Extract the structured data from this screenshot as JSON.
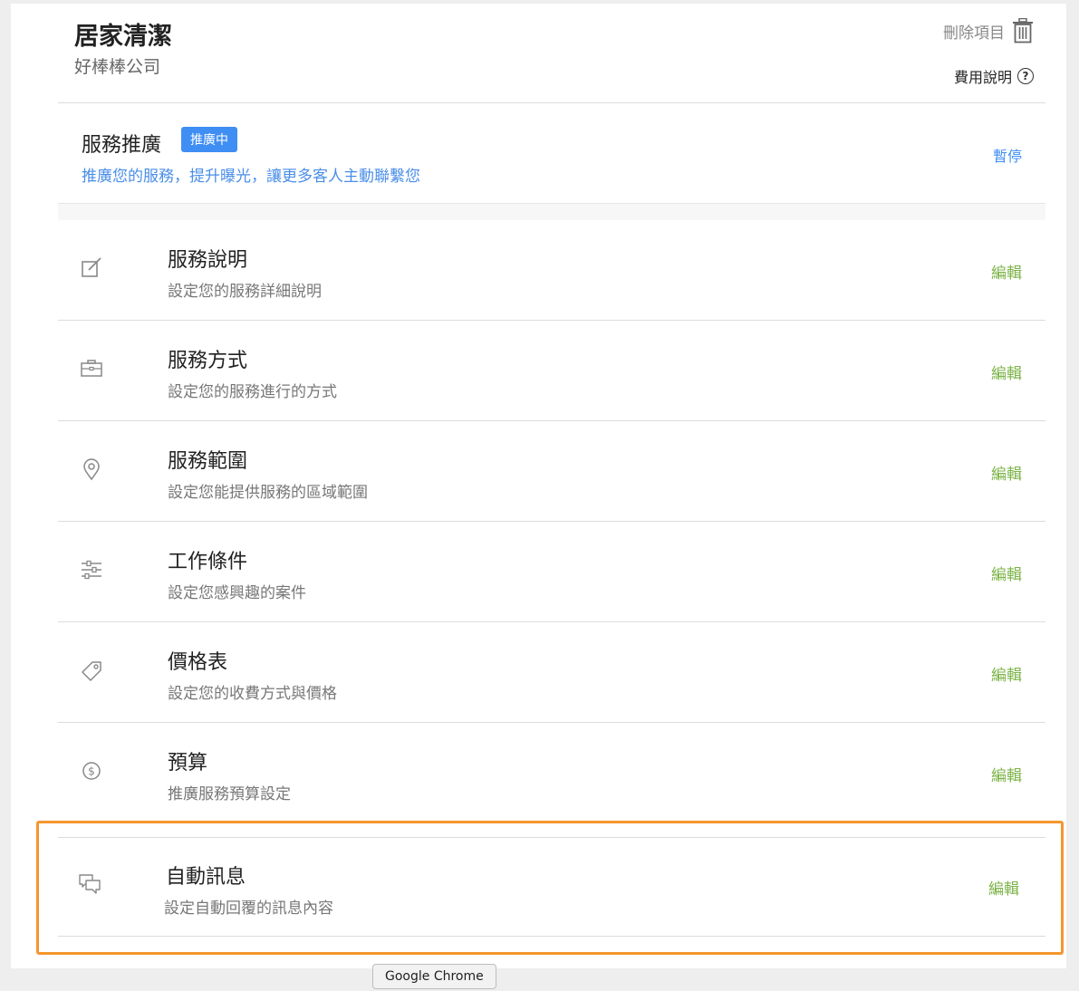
{
  "header": {
    "title": "居家清潔",
    "subtitle": "好棒棒公司",
    "delete_label": "刪除項目",
    "fee_label": "費用說明",
    "help_icon_text": "?"
  },
  "promotion": {
    "title": "服務推廣",
    "badge": "推廣中",
    "description": "推廣您的服務，提升曝光，讓更多客人主動聯繫您",
    "pause_label": "暫停"
  },
  "items": [
    {
      "title": "服務說明",
      "description": "設定您的服務詳細說明",
      "edit": "編輯",
      "icon": "edit-icon"
    },
    {
      "title": "服務方式",
      "description": "設定您的服務進行的方式",
      "edit": "編輯",
      "icon": "briefcase-icon"
    },
    {
      "title": "服務範圍",
      "description": "設定您能提供服務的區域範圍",
      "edit": "編輯",
      "icon": "location-pin-icon"
    },
    {
      "title": "工作條件",
      "description": "設定您感興趣的案件",
      "edit": "編輯",
      "icon": "sliders-icon"
    },
    {
      "title": "價格表",
      "description": "設定您的收費方式與價格",
      "edit": "編輯",
      "icon": "price-tag-icon"
    },
    {
      "title": "預算",
      "description": "推廣服務預算設定",
      "edit": "編輯",
      "icon": "dollar-icon"
    },
    {
      "title": "自動訊息",
      "description": "設定自動回覆的訊息內容",
      "edit": "編輯",
      "icon": "chat-icon"
    }
  ],
  "tooltip": "Google Chrome",
  "colors": {
    "accent_blue": "#3f8ef4",
    "edit_green": "#7cb347",
    "highlight_orange": "#f5962e"
  }
}
